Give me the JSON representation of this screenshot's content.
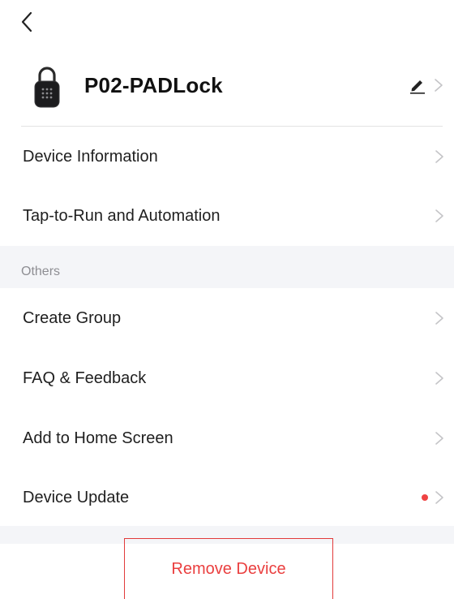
{
  "device": {
    "name": "P02-PADLock"
  },
  "menu_primary": [
    {
      "label": "Device Information"
    },
    {
      "label": "Tap-to-Run and Automation"
    }
  ],
  "section": {
    "title": "Others"
  },
  "menu_others": [
    {
      "label": "Create Group"
    },
    {
      "label": "FAQ & Feedback"
    },
    {
      "label": "Add to Home Screen"
    },
    {
      "label": "Device Update"
    }
  ],
  "footer": {
    "remove_label": "Remove Device"
  },
  "icons": {
    "back": "chevron-left-icon",
    "device": "padlock-icon",
    "edit": "pencil-icon",
    "row": "chevron-right-icon"
  },
  "colors": {
    "accent_red": "#ea3f3f",
    "update_dot": "#ef4343",
    "section_bg": "#f4f5f8",
    "chevron": "#c4c4c7"
  }
}
